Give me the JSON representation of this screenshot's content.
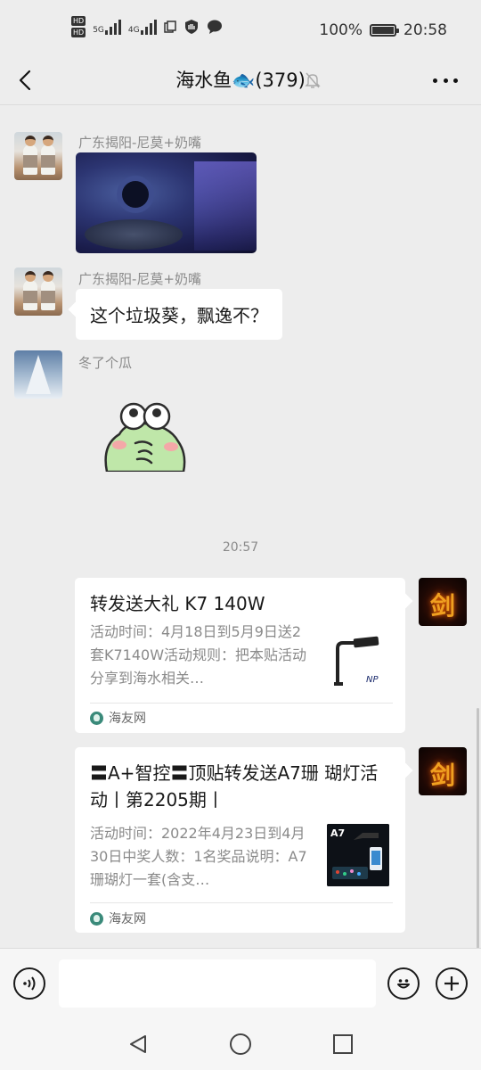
{
  "status_bar": {
    "hd1": "HD",
    "hd2": "HD",
    "net1": "5G",
    "net2": "4G",
    "battery_text": "100%",
    "battery_level": 1.0,
    "time": "20:58"
  },
  "header": {
    "title": "海水鱼🐟(379)",
    "muted": true
  },
  "messages": [
    {
      "type": "image",
      "sender": "广东揭阳-尼莫+奶嘴",
      "avatar": "kids-photo",
      "side": "left"
    },
    {
      "type": "text",
      "sender": "广东揭阳-尼莫+奶嘴",
      "avatar": "kids-photo",
      "side": "left",
      "text": "这个垃圾葵，飘逸不？"
    },
    {
      "type": "sticker",
      "sender": "冬了个瓜",
      "avatar": "snow-tree",
      "side": "left"
    }
  ],
  "time_divider": "20:57",
  "cards": [
    {
      "title": "转发送大礼 K7 140W",
      "description": "活动时间：4月18日到5月9日送2套K7140W活动规则：把本贴活动分享到海水相关…",
      "source": "海友网",
      "thumbnail": "led-light-k7",
      "thumb_label": "NP",
      "avatar": "sword-logo",
      "avatar_char": "剑"
    },
    {
      "title": "〓A+智控〓顶贴转发送A7珊 瑚灯活动丨第2205期丨",
      "description": "活动时间：2022年4月23日到4月30日中奖人数：1名奖品说明：A7珊瑚灯一套(含支…",
      "source": "海友网",
      "thumbnail": "led-light-a7",
      "thumb_label": "A7",
      "avatar": "sword-logo",
      "avatar_char": "剑"
    }
  ],
  "input_bar": {
    "placeholder": "",
    "value": ""
  },
  "icons": {
    "back": "chevron-left-icon",
    "mute": "bell-off-icon",
    "more": "more-dots-icon",
    "voice": "voice-icon",
    "emoji": "emoji-icon",
    "plus": "plus-icon"
  },
  "colors": {
    "background": "#ededed",
    "bubble": "#ffffff",
    "secondary_text": "#8a8a8a"
  }
}
